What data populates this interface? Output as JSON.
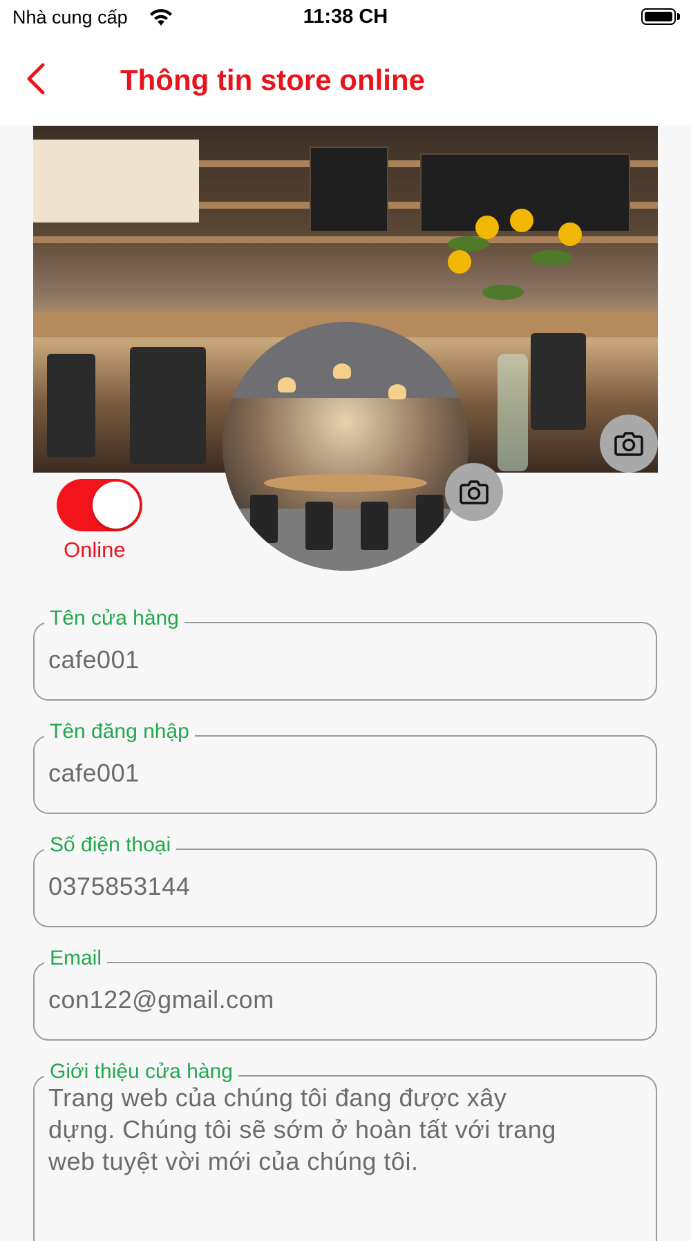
{
  "status_bar": {
    "carrier": "Nhà cung cấp",
    "time": "11:38 CH"
  },
  "header": {
    "title": "Thông tin store online",
    "accent_color": "#e8141b"
  },
  "cover_image": {
    "camera_icon": "camera-icon"
  },
  "avatar_image": {
    "camera_icon": "camera-icon"
  },
  "status_toggle": {
    "on": true,
    "label": "Online"
  },
  "form": {
    "label_color": "#23a74e",
    "fields": [
      {
        "label": "Tên cửa hàng",
        "value": "cafe001"
      },
      {
        "label": "Tên đăng nhập",
        "value": "cafe001"
      },
      {
        "label": "Số điện thoại",
        "value": "0375853144"
      },
      {
        "label": "Email",
        "value": "con122@gmail.com"
      }
    ],
    "description": {
      "label": "Giới thiệu cửa hàng",
      "value": "Trang web của chúng tôi đang được xây dựng. Chúng tôi sẽ sớm ở hoàn tất với trang web tuyệt vời mới của chúng tôi."
    }
  }
}
